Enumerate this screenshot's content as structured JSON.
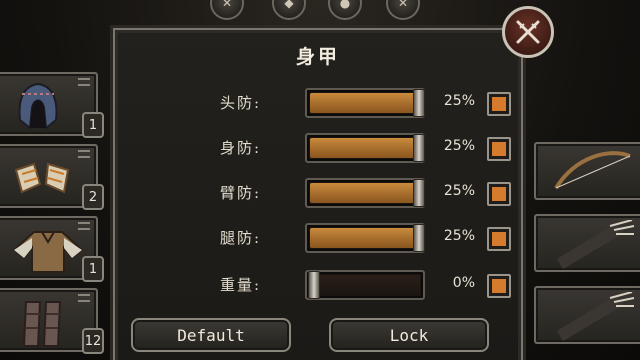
{
  "panel": {
    "title": "身甲",
    "rows": [
      {
        "label": "头防:",
        "percent": "25%",
        "value": 25,
        "checked": true
      },
      {
        "label": "身防:",
        "percent": "25%",
        "value": 25,
        "checked": true
      },
      {
        "label": "臂防:",
        "percent": "25%",
        "value": 25,
        "checked": true
      },
      {
        "label": "腿防:",
        "percent": "25%",
        "value": 25,
        "checked": true
      },
      {
        "label": "重量:",
        "percent": "0%",
        "value": 0,
        "checked": true
      }
    ],
    "buttons": {
      "default_label": "Default",
      "lock_label": "Lock"
    }
  },
  "left_slots": [
    {
      "icon": "hood-icon",
      "count": "1"
    },
    {
      "icon": "gauntlets-icon",
      "count": "2"
    },
    {
      "icon": "tunic-icon",
      "count": "1"
    },
    {
      "icon": "boots-icon",
      "count": "12"
    }
  ],
  "right_slots": [
    {
      "icon": "bow-icon"
    },
    {
      "icon": "quiver-icon"
    },
    {
      "icon": "quiver-icon"
    }
  ],
  "colors": {
    "accent": "#d47b2d",
    "fill": "#c98b3d"
  }
}
